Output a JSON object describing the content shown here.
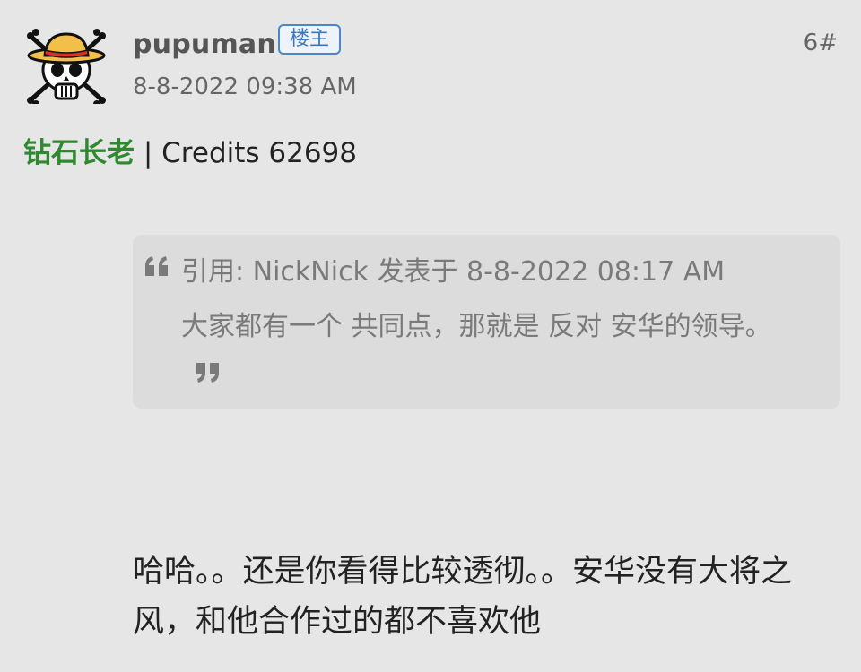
{
  "post": {
    "username": "pupuman",
    "op_badge": "楼主",
    "floor": "6#",
    "time": "8-8-2022 09:38 AM",
    "user_rank": "钻石长老",
    "credits_text": "| Credits 62698"
  },
  "quote": {
    "header": "引用: NickNick 发表于 8-8-2022 08:17 AM",
    "text": "大家都有一个 共同点，那就是 反对 安华的领导。"
  },
  "body": {
    "text": "哈哈。。还是你看得比较透彻。。安华没有大将之风，和他合作过的都不喜欢他"
  },
  "icons": {
    "avatar": "straw-hat-skull-avatar",
    "quote_open": "quote-open-icon",
    "quote_close": "quote-close-icon"
  },
  "colors": {
    "background": "#e6e6e6",
    "quote_background": "#dcdcdc",
    "rank_green": "#2f8a2f",
    "badge_blue": "#3b78c0"
  }
}
